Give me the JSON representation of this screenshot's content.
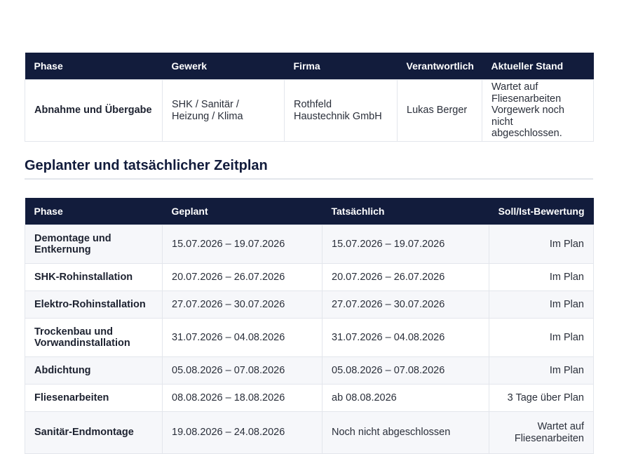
{
  "table1": {
    "headers": [
      "Phase",
      "Gewerk",
      "Firma",
      "Verantwortlich",
      "Aktueller Stand"
    ],
    "row": {
      "phase": "Abnahme und Übergabe",
      "gewerk": "SHK / Sanitär / Heizung / Klima",
      "firma": "Rothfeld Haustechnik GmbH",
      "verantwortlich": "Lukas Berger",
      "stand": "Wartet auf Fliesenarbeiten Vorgewerk noch nicht abgeschlossen."
    }
  },
  "section_title": "Geplanter und tatsächlicher Zeitplan",
  "table2": {
    "headers": [
      "Phase",
      "Geplant",
      "Tatsächlich",
      "Soll/Ist-Bewertung"
    ],
    "rows": [
      {
        "phase": "Demontage und Entkernung",
        "geplant": "15.07.2026 – 19.07.2026",
        "tatsaechlich": "15.07.2026 – 19.07.2026",
        "bewertung": "Im Plan"
      },
      {
        "phase": "SHK-Rohinstallation",
        "geplant": "20.07.2026 – 26.07.2026",
        "tatsaechlich": "20.07.2026 – 26.07.2026",
        "bewertung": "Im Plan"
      },
      {
        "phase": "Elektro-Rohinstallation",
        "geplant": "27.07.2026 – 30.07.2026",
        "tatsaechlich": "27.07.2026 – 30.07.2026",
        "bewertung": "Im Plan"
      },
      {
        "phase": "Trockenbau und Vorwandinstallation",
        "geplant": "31.07.2026 – 04.08.2026",
        "tatsaechlich": "31.07.2026 – 04.08.2026",
        "bewertung": "Im Plan"
      },
      {
        "phase": "Abdichtung",
        "geplant": "05.08.2026 – 07.08.2026",
        "tatsaechlich": "05.08.2026 – 07.08.2026",
        "bewertung": "Im Plan"
      },
      {
        "phase": "Fliesenarbeiten",
        "geplant": "08.08.2026 – 18.08.2026",
        "tatsaechlich": "ab 08.08.2026",
        "bewertung": "3 Tage über Plan"
      },
      {
        "phase": "Sanitär-Endmontage",
        "geplant": "19.08.2026 – 24.08.2026",
        "tatsaechlich": "Noch nicht abgeschlossen",
        "bewertung": "Wartet auf Fliesenarbeiten"
      }
    ]
  }
}
